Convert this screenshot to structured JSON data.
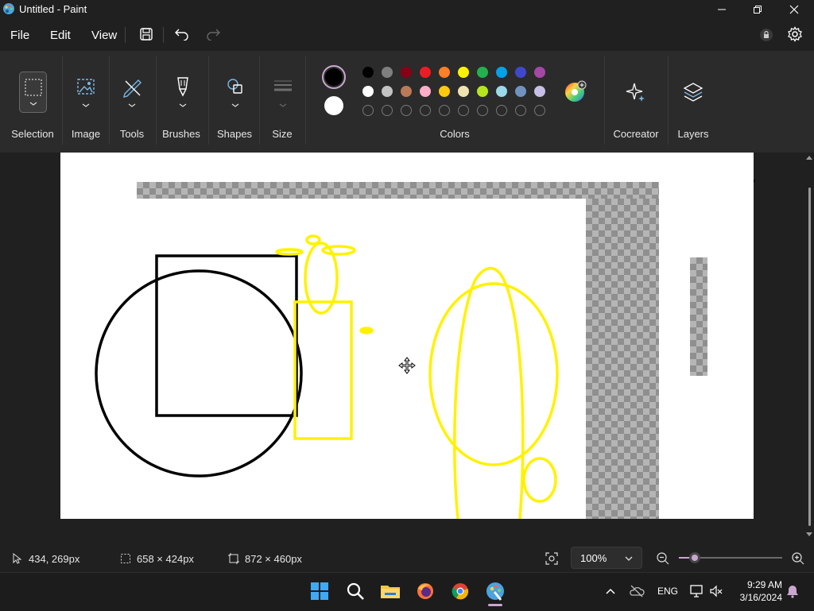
{
  "window": {
    "title": "Untitled - Paint",
    "app_icon": "paint-palette-icon",
    "controls": [
      "minimize-icon",
      "restore-icon",
      "close-icon"
    ]
  },
  "menu": {
    "items": [
      {
        "label": "File"
      },
      {
        "label": "Edit"
      },
      {
        "label": "View"
      }
    ],
    "quick_actions": [
      "save-icon",
      "undo-icon",
      "redo-icon"
    ],
    "right_icons": [
      "account-icon",
      "settings-gear-icon"
    ]
  },
  "ribbon": {
    "groups": [
      {
        "label": "Selection",
        "icon": "selection-rectangle-icon"
      },
      {
        "label": "Image",
        "icon": "image-icon"
      },
      {
        "label": "Tools",
        "icon": "pencil-tools-icon"
      },
      {
        "label": "Brushes",
        "icon": "brush-icon"
      },
      {
        "label": "Shapes",
        "icon": "shapes-icon"
      },
      {
        "label": "Size",
        "icon": "line-size-icon"
      },
      {
        "label": "Colors",
        "icon": "color-palette-icon"
      },
      {
        "label": "Cocreator",
        "icon": "sparkle-icon"
      },
      {
        "label": "Layers",
        "icon": "layers-icon"
      }
    ],
    "primary_color": "#000000",
    "secondary_color": "#ffffff",
    "palette_row1": [
      "#000000",
      "#7f7f7f",
      "#880015",
      "#ed1c24",
      "#ff7f27",
      "#fff200",
      "#22b14c",
      "#00a2e8",
      "#3f48cc",
      "#a349a4"
    ],
    "palette_row2": [
      "#ffffff",
      "#c3c3c3",
      "#b97a57",
      "#ffaec9",
      "#ffc90e",
      "#efe4b0",
      "#b5e61d",
      "#99d9ea",
      "#7092be",
      "#c8bfe7"
    ],
    "palette_row3_empty_slots": 10
  },
  "canvas": {
    "background": "#ffffff",
    "stroke_colors": {
      "black": "#000000",
      "yellow": "#fff200"
    },
    "cursor_icon": "move-cursor-icon"
  },
  "status": {
    "cursor_icon": "pointer-icon",
    "cursor_position": "434, 269px",
    "selection_icon": "selection-size-icon",
    "selection_size": "658 × 424px",
    "canvas_icon": "canvas-size-icon",
    "canvas_size": "872 × 460px",
    "zoom": "100%",
    "zoom_slider_fraction": 0.15
  },
  "taskbar": {
    "apps": [
      "windows-start-icon",
      "search-icon",
      "file-explorer-icon",
      "firefox-icon",
      "chrome-icon",
      "paint-icon"
    ],
    "tray": {
      "language": "ENG",
      "time": "9:29 AM",
      "date": "3/16/2024"
    }
  }
}
